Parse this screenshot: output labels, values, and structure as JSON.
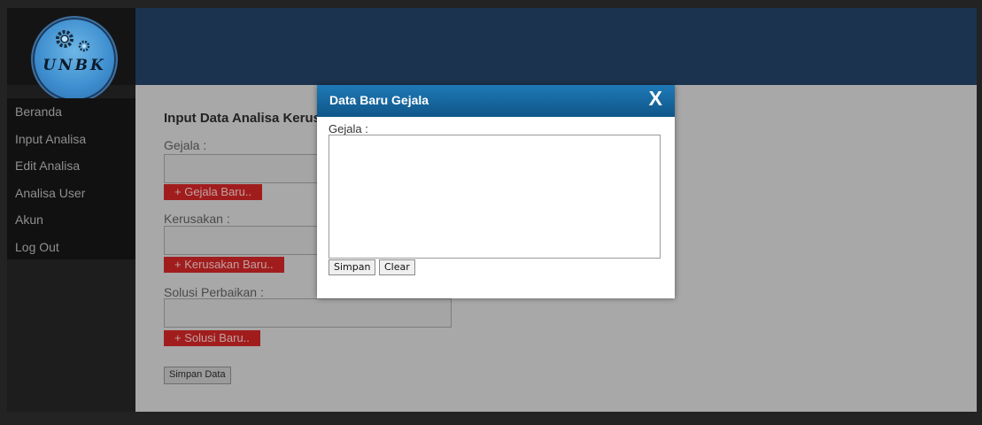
{
  "brand": {
    "logo_text": "UNBK"
  },
  "colors": {
    "header_bg": "#1c334f",
    "modal_header": "#1f7ab7",
    "red_button": "#a11d1d"
  },
  "sidebar": {
    "items": [
      {
        "label": "Beranda"
      },
      {
        "label": "Input Analisa"
      },
      {
        "label": "Edit Analisa"
      },
      {
        "label": "Analisa User"
      },
      {
        "label": "Akun"
      },
      {
        "label": "Log Out"
      }
    ]
  },
  "form": {
    "title": "Input Data Analisa Kerusakan",
    "gejala_label": "Gejala :",
    "gejala_button": "+ Gejala Baru..",
    "kerusakan_label": "Kerusakan :",
    "kerusakan_button": "+ Kerusakan Baru..",
    "solusi_label": "Solusi Perbaikan :",
    "solusi_button": "+ Solusi Baru..",
    "save_button": "Simpan Data"
  },
  "modal": {
    "title": "Data Baru Gejala",
    "close_label": "X",
    "field_label": "Gejala :",
    "field_value": "",
    "save_button": "Simpan",
    "clear_button": "Clear"
  }
}
